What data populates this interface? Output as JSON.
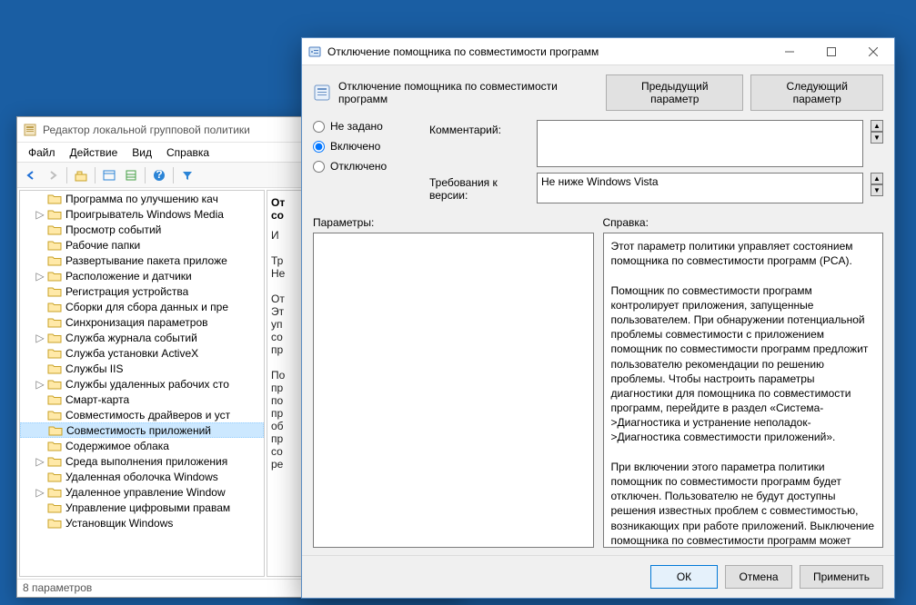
{
  "gpe": {
    "title": "Редактор локальной групповой политики",
    "menus": [
      "Файл",
      "Действие",
      "Вид",
      "Справка"
    ],
    "status": "8 параметров",
    "tree": [
      {
        "label": "Программа по улучшению кач",
        "exp": false
      },
      {
        "label": "Проигрыватель Windows Media",
        "exp": true
      },
      {
        "label": "Просмотр событий",
        "exp": false
      },
      {
        "label": "Рабочие папки",
        "exp": false
      },
      {
        "label": "Развертывание пакета приложе",
        "exp": false
      },
      {
        "label": "Расположение и датчики",
        "exp": true
      },
      {
        "label": "Регистрация устройства",
        "exp": false
      },
      {
        "label": "Сборки для сбора данных и пре",
        "exp": false
      },
      {
        "label": "Синхронизация параметров",
        "exp": false
      },
      {
        "label": "Служба журнала событий",
        "exp": true
      },
      {
        "label": "Служба установки ActiveX",
        "exp": false
      },
      {
        "label": "Службы IIS",
        "exp": false
      },
      {
        "label": "Службы удаленных рабочих сто",
        "exp": true
      },
      {
        "label": "Смарт-карта",
        "exp": false
      },
      {
        "label": "Совместимость драйверов и уст",
        "exp": false
      },
      {
        "label": "Совместимость приложений",
        "exp": false,
        "sel": true
      },
      {
        "label": "Содержимое облака",
        "exp": false
      },
      {
        "label": "Среда выполнения приложения",
        "exp": true
      },
      {
        "label": "Удаленная оболочка Windows",
        "exp": false
      },
      {
        "label": "Удаленное управление Window",
        "exp": true
      },
      {
        "label": "Управление цифровыми правам",
        "exp": false
      },
      {
        "label": "Установщик Windows",
        "exp": false
      }
    ],
    "right_title_1": "От",
    "right_title_2": "со",
    "right_frag": "И\n\nТр\nНе\n\nОт\nЭт\nуп\nсо\nпр\n\nПо\nпр\nпо\nпр\nоб\nпр\nсо\nре"
  },
  "policy": {
    "win_title": "Отключение помощника по совместимости программ",
    "heading": "Отключение помощника по совместимости программ",
    "prev_btn": "Предыдущий параметр",
    "next_btn": "Следующий параметр",
    "radio_notconf": "Не задано",
    "radio_enabled": "Включено",
    "radio_disabled": "Отключено",
    "comment_label": "Комментарий:",
    "comment_value": "",
    "version_label": "Требования к версии:",
    "version_value": "Не ниже Windows Vista",
    "params_label": "Параметры:",
    "help_label": "Справка:",
    "help_text": "Этот параметр политики управляет состоянием помощника по совместимости программ (PCA).\n\nПомощник по совместимости программ контролирует приложения, запущенные пользователем. При обнаружении потенциальной проблемы совместимости с приложением помощник по совместимости программ предложит пользователю рекомендации по решению проблемы. Чтобы настроить параметры диагностики для помощника по совместимости программ, перейдите в раздел «Система->Диагностика и устранение неполадок->Диагностика совместимости приложений».\n\nПри включении этого параметра политики помощник по совместимости программ будет отключен. Пользователю не будут доступны решения известных проблем с совместимостью, возникающих при работе приложений. Выключение помощника по совместимости программ может быть полезно, если системный администратор уже знает о проблемах совместимости приложений и хочет",
    "ok": "ОК",
    "cancel": "Отмена",
    "apply": "Применить"
  }
}
